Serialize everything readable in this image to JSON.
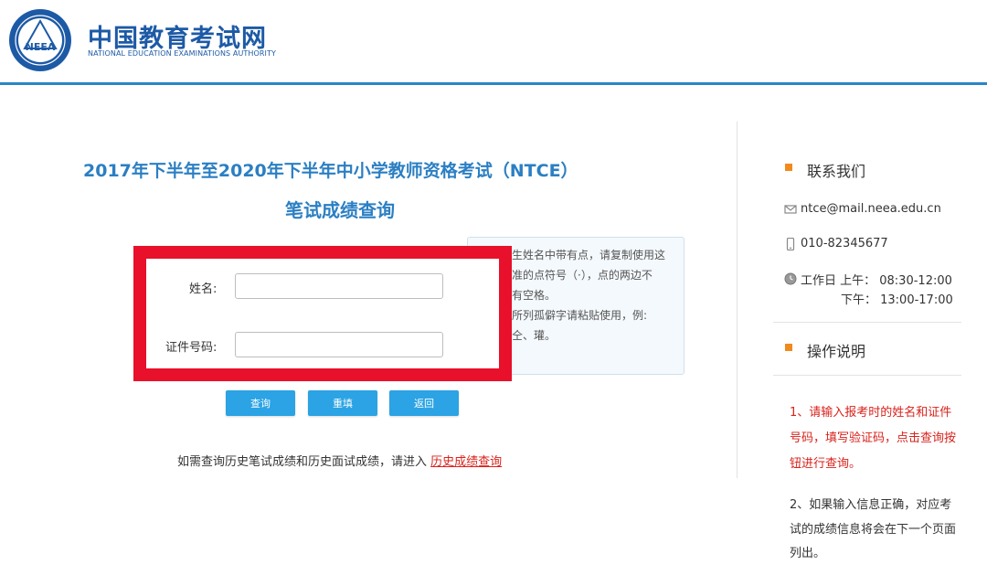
{
  "header": {
    "logo_emblem_text": "NEEA",
    "title": "中国教育考试网",
    "subtitle": "NATIONAL EDUCATION EXAMINATIONS AUTHORITY"
  },
  "main": {
    "title": "2017年下半年至2020年下半年中小学教师资格考试（NTCE）",
    "subtitle": "笔试成绩查询",
    "form": {
      "name_label": "姓名:",
      "name_value": "",
      "id_label": "证件号码:",
      "id_value": ""
    },
    "hint": {
      "lines": [
        "考生姓名中带有点，请复制使用这",
        "标准的点符号（·），点的两边不",
        "再有空格。",
        "有所列孤僻字请粘贴使用，例:",
        "、仝、瓘。"
      ]
    },
    "buttons": {
      "query": "查询",
      "reset": "重填",
      "back": "返回"
    },
    "history": {
      "text": "如需查询历史笔试成绩和历史面试成绩，请进入",
      "link": "历史成绩查询"
    }
  },
  "sidebar": {
    "contact": {
      "title": "联系我们",
      "email": "ntce@mail.neea.edu.cn",
      "phone": "010-82345677",
      "hours_am": "工作日 上午： 08:30-12:00",
      "hours_pm": "下午： 13:00-17:00"
    },
    "instructions": {
      "title": "操作说明",
      "item1_lines": [
        "1、请输入报考时的姓名和证件",
        "号码，填写验证码，点击查询按",
        "钮进行查询。"
      ],
      "item2_lines": [
        "2、如果输入信息正确，对应考",
        "试的成绩信息将会在下一个页面",
        "列出。"
      ]
    }
  },
  "colors": {
    "brand": "#1d5aa6",
    "title_blue": "#2b7fc3",
    "button": "#2ba3e4",
    "highlight": "#e8102a",
    "bullet": "#f08a1c",
    "instr_red": "#d9221b"
  }
}
